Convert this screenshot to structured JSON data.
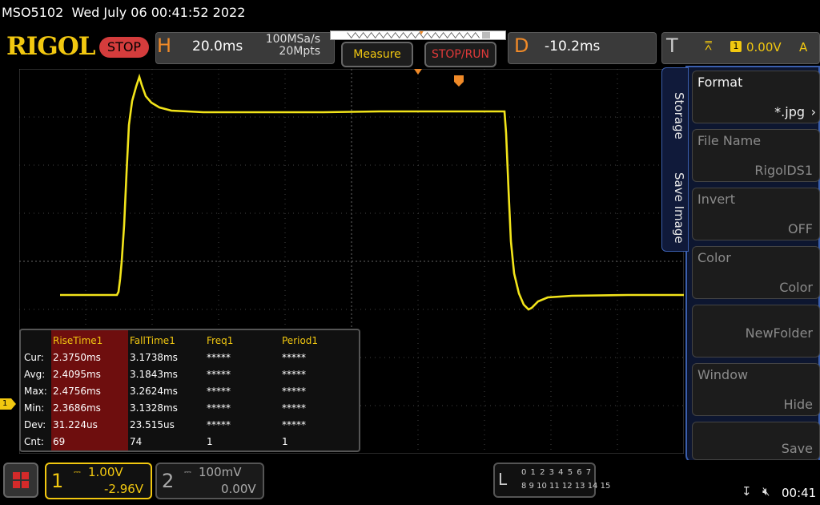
{
  "topbar": {
    "model_datetime": "MSO5102  Wed July 06 00:41:52 2022",
    "logo": "RIGOL",
    "run_state": "STOP"
  },
  "horizontal": {
    "letter": "H",
    "timebase": "20.0ms",
    "sample_rate": "100MSa/s",
    "memory_depth": "20Mpts"
  },
  "buttons": {
    "measure": "Measure",
    "stop_run": "STOP/RUN"
  },
  "delay": {
    "letter": "D",
    "value": "-10.2ms"
  },
  "trigger": {
    "letter": "T",
    "source": "1",
    "level": "0.00V",
    "mode": "A",
    "edge_icon": "rising-edge-icon"
  },
  "channel_marker": "1",
  "measurements": {
    "headers": [
      "RiseTime1",
      "FallTime1",
      "Freq1",
      "Period1"
    ],
    "rows": [
      {
        "label": "Cur:",
        "values": [
          "2.3750ms",
          "3.1738ms",
          "*****",
          "*****"
        ]
      },
      {
        "label": "Avg:",
        "values": [
          "2.4095ms",
          "3.1843ms",
          "*****",
          "*****"
        ]
      },
      {
        "label": "Max:",
        "values": [
          "2.4756ms",
          "3.2624ms",
          "*****",
          "*****"
        ]
      },
      {
        "label": "Min:",
        "values": [
          "2.3686ms",
          "3.1328ms",
          "*****",
          "*****"
        ]
      },
      {
        "label": "Dev:",
        "values": [
          "31.224us",
          "23.515us",
          "*****",
          "*****"
        ]
      },
      {
        "label": "Cnt:",
        "values": [
          "69",
          "74",
          "1",
          "1"
        ]
      }
    ]
  },
  "side_menu": {
    "tabs": [
      "Storage",
      "Save Image"
    ],
    "items": [
      {
        "title": "Format",
        "value": "*.jpg",
        "enabled": true,
        "arrow": "chevron-right-icon"
      },
      {
        "title": "File Name",
        "value": "RigolDS1",
        "enabled": false
      },
      {
        "title": "Invert",
        "value": "OFF",
        "enabled": false
      },
      {
        "title": "Color",
        "value": "Color",
        "enabled": false
      },
      {
        "title": "",
        "value": "NewFolder",
        "enabled": false
      },
      {
        "title": "Window",
        "value": "Hide",
        "enabled": false
      },
      {
        "title": "",
        "value": "Save",
        "enabled": false
      }
    ]
  },
  "channels": [
    {
      "number": "1",
      "scale": "1.00V",
      "offset": "-2.96V",
      "color": "#f2c810"
    },
    {
      "number": "2",
      "scale": "100mV",
      "offset": "0.00V",
      "color": "#aaaaaa"
    }
  ],
  "la": {
    "letter": "L",
    "row1": "0 1 2 3  4 5 6 7",
    "row2": "8 9 10 11 12 13 14 15"
  },
  "status": {
    "time": "00:41",
    "usb_icon": "usb-icon",
    "mute_icon": "speaker-mute-icon"
  }
}
